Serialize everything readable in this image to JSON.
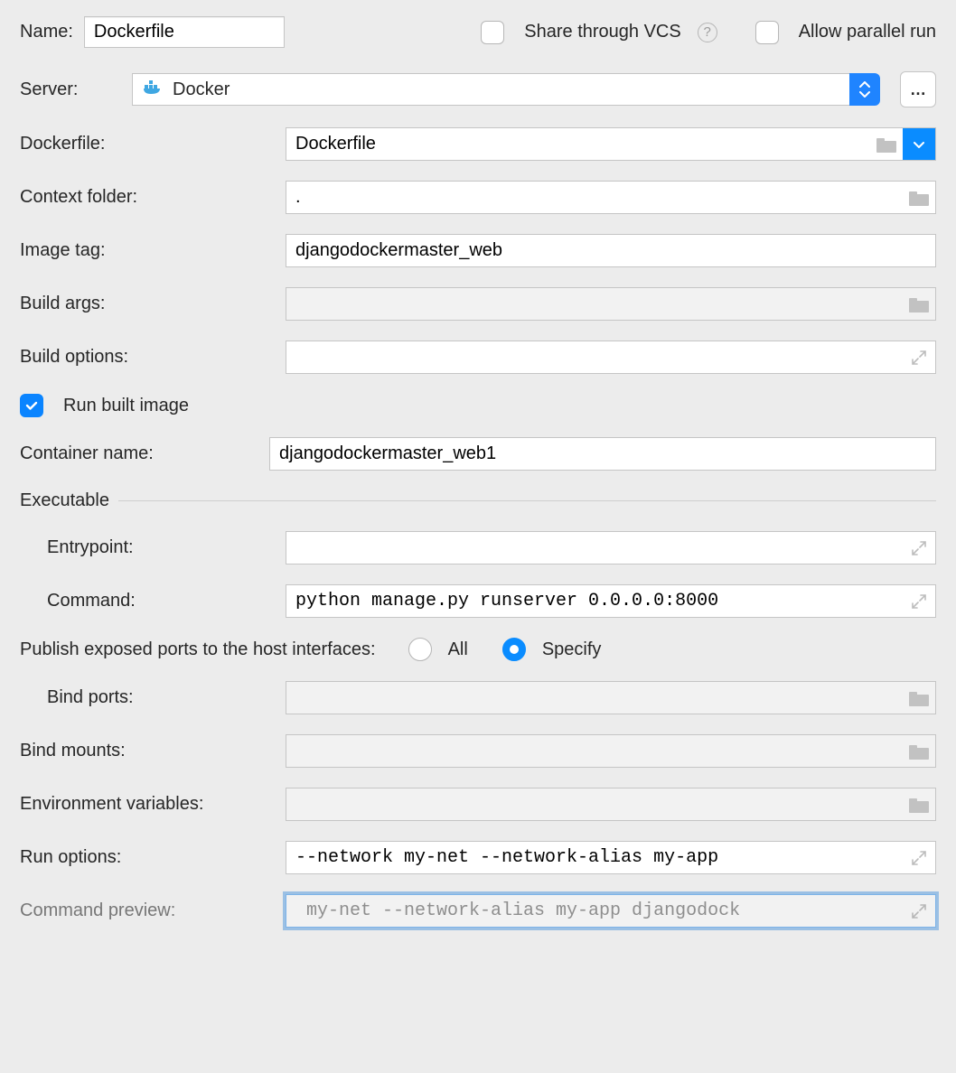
{
  "name": {
    "label": "Name:",
    "value": "Dockerfile"
  },
  "share_vcs": {
    "label": "Share through VCS",
    "checked": false
  },
  "allow_parallel": {
    "label": "Allow parallel run",
    "checked": false
  },
  "server": {
    "label": "Server:",
    "selected": "Docker"
  },
  "dockerfile": {
    "label": "Dockerfile:",
    "value": "Dockerfile"
  },
  "context_folder": {
    "label": "Context folder:",
    "value": "."
  },
  "image_tag": {
    "label": "Image tag:",
    "value": "djangodockermaster_web"
  },
  "build_args": {
    "label": "Build args:",
    "value": ""
  },
  "build_options": {
    "label": "Build options:",
    "value": ""
  },
  "run_built_image": {
    "label": "Run built image",
    "checked": true
  },
  "container_name": {
    "label": "Container name:",
    "value": "djangodockermaster_web1"
  },
  "executable_section": "Executable",
  "entrypoint": {
    "label": "Entrypoint:",
    "value": ""
  },
  "command": {
    "label": "Command:",
    "value": "python manage.py runserver 0.0.0.0:8000"
  },
  "publish_ports": {
    "label": "Publish exposed ports to the host interfaces:",
    "all_label": "All",
    "specify_label": "Specify",
    "selected": "specify"
  },
  "bind_ports": {
    "label": "Bind ports:",
    "value": ""
  },
  "bind_mounts": {
    "label": "Bind mounts:",
    "value": ""
  },
  "env_vars": {
    "label": "Environment variables:",
    "value": ""
  },
  "run_options": {
    "label": "Run options:",
    "value": "--network my-net --network-alias my-app"
  },
  "command_preview": {
    "label": "Command preview:",
    "value": " my-net --network-alias my-app djangodock"
  }
}
